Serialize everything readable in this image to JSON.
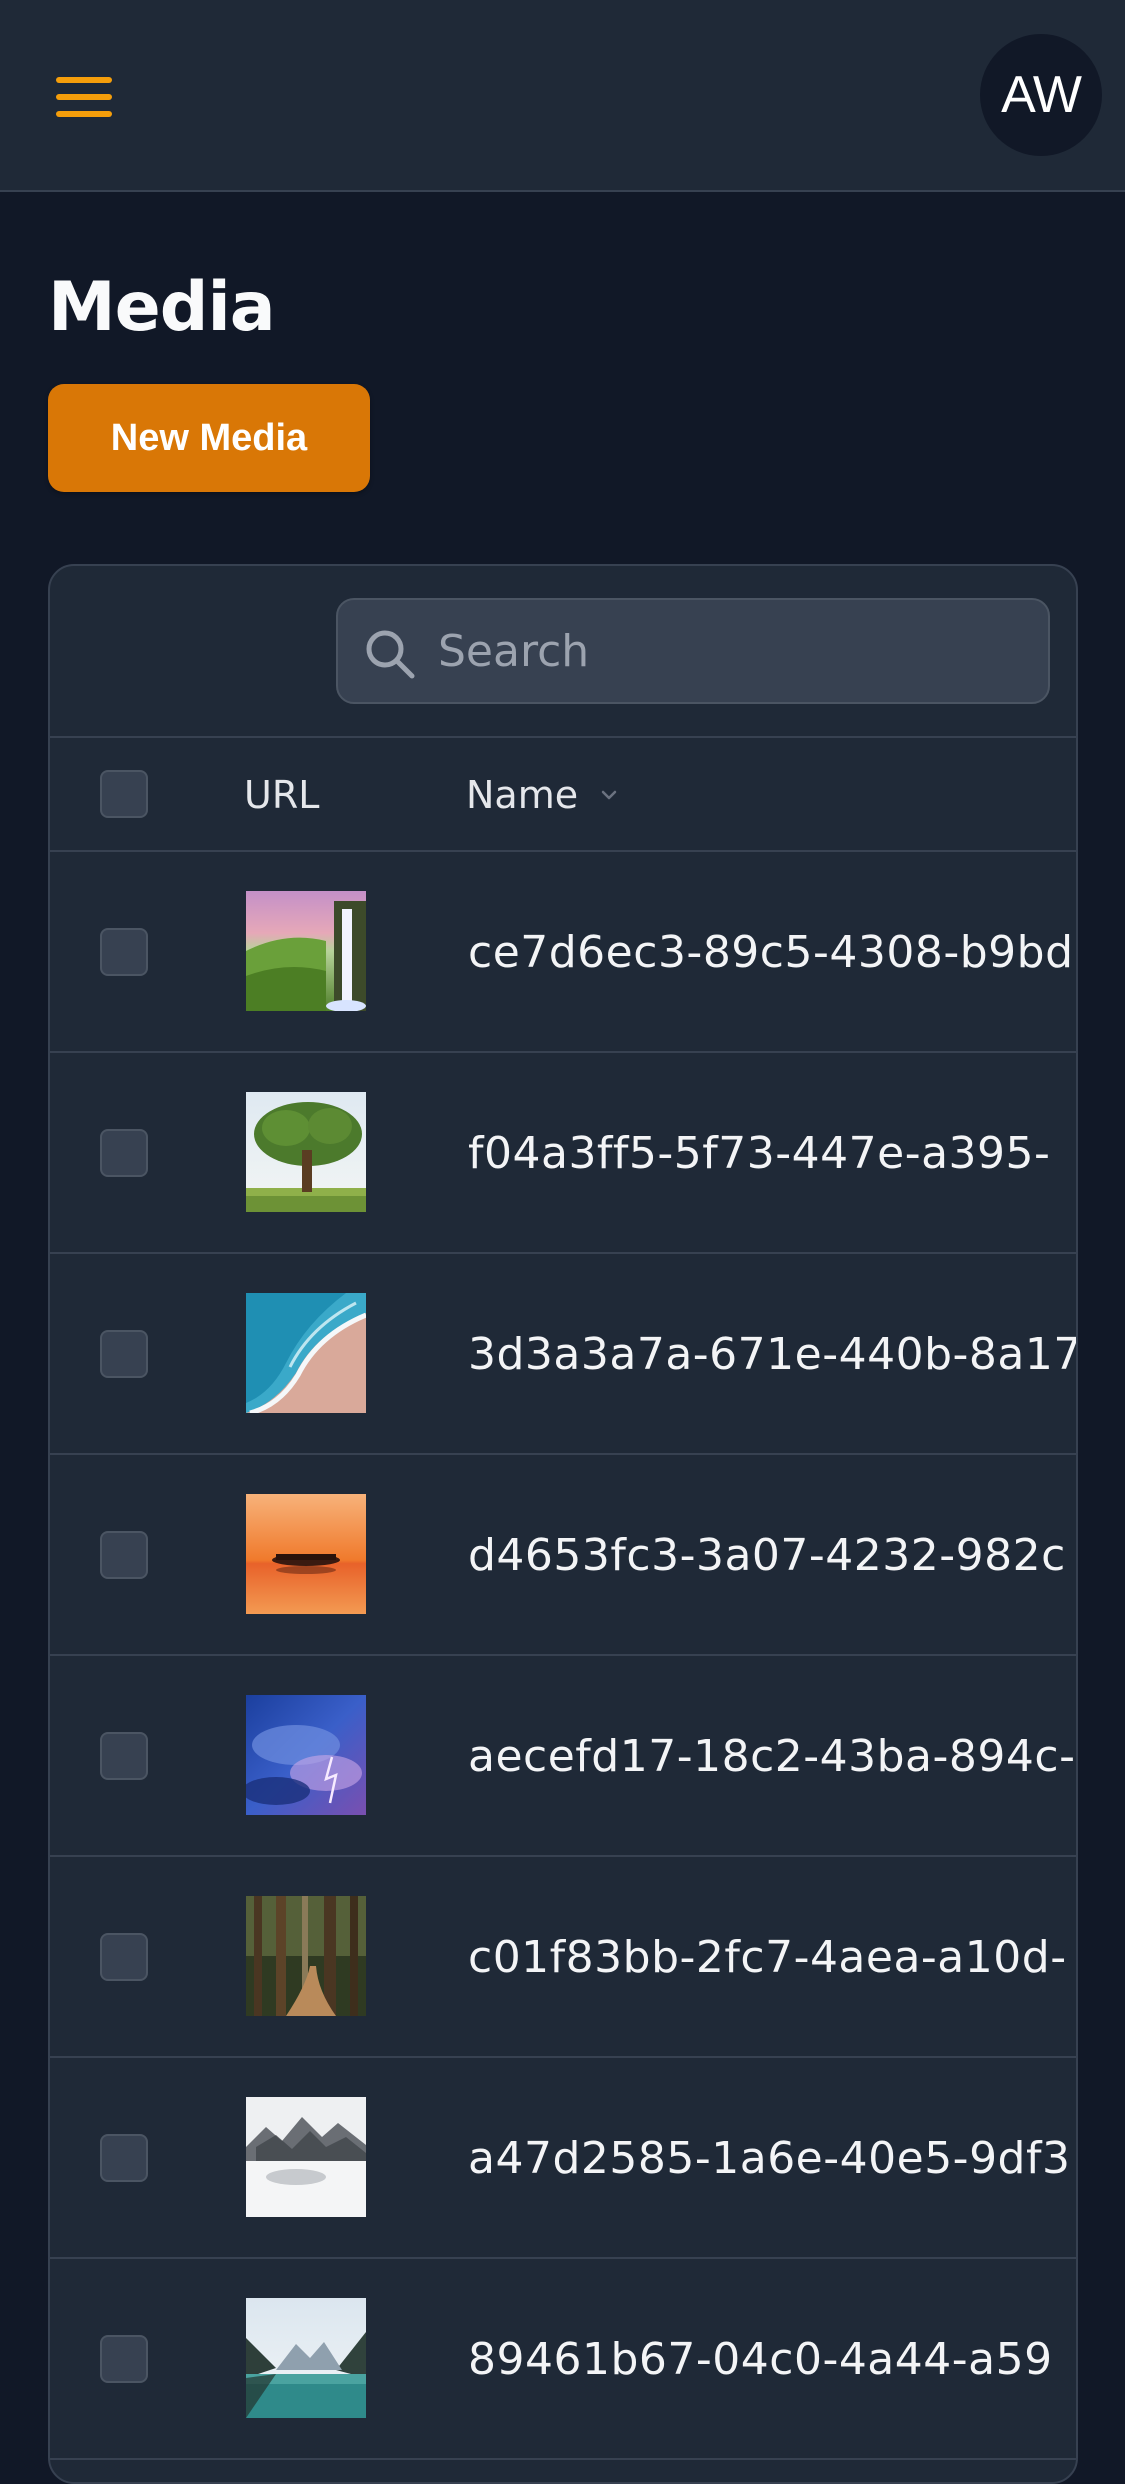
{
  "header": {
    "menu_icon": "hamburger-icon",
    "avatar_initials": "AW",
    "accent_color": "#f59e0b"
  },
  "page": {
    "title": "Media",
    "new_button_label": "New Media"
  },
  "table": {
    "search_placeholder": "Search",
    "search_value": "",
    "columns": {
      "url": "URL",
      "name": "Name"
    },
    "sort_icon": "chevron-down-icon",
    "rows": [
      {
        "thumbnail": "waterfall-image",
        "name": "ce7d6ec3-89c5-4308-b9bd"
      },
      {
        "thumbnail": "tree-image",
        "name": "f04a3ff5-5f73-447e-a395-"
      },
      {
        "thumbnail": "beach-image",
        "name": "3d3a3a7a-671e-440b-8a17-"
      },
      {
        "thumbnail": "sunset-image",
        "name": "d4653fc3-3a07-4232-982c"
      },
      {
        "thumbnail": "storm-image",
        "name": "aecefd17-18c2-43ba-894c-"
      },
      {
        "thumbnail": "forest-image",
        "name": "c01f83bb-2fc7-4aea-a10d-"
      },
      {
        "thumbnail": "mountain-fog-image",
        "name": "a47d2585-1a6e-40e5-9df3"
      },
      {
        "thumbnail": "lake-image",
        "name": "89461b67-04c0-4a44-a59"
      }
    ]
  },
  "colors": {
    "page_bg": "#111827",
    "surface": "#1f2937",
    "border": "#374151",
    "primary_button": "#d97706"
  }
}
